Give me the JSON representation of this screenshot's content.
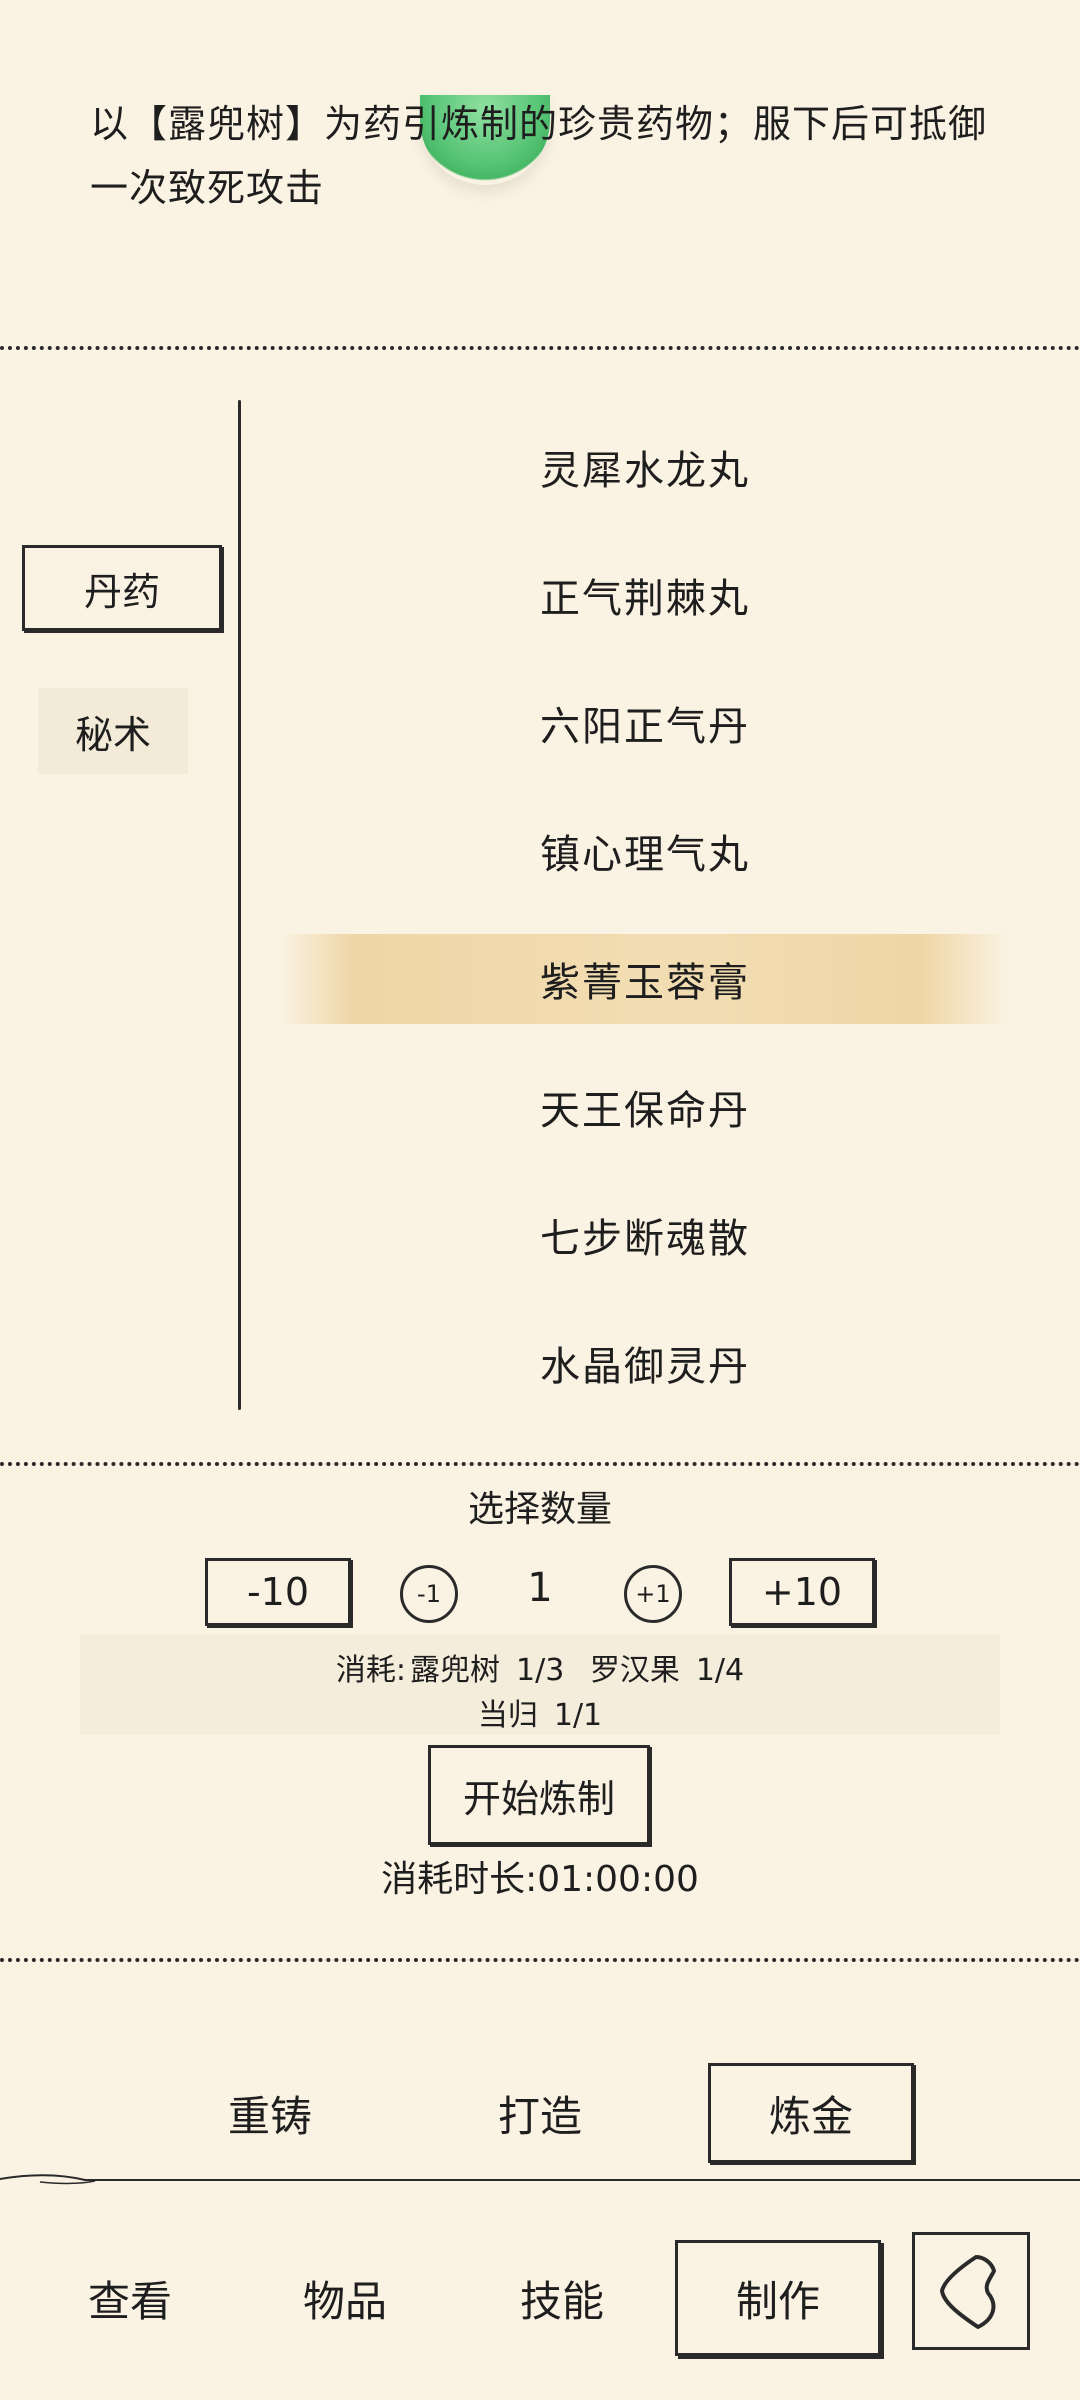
{
  "description": {
    "line1": "以【露兜树】为药引炼制的珍贵药物；服下后可抵御",
    "line2": "一次致死攻击"
  },
  "categories": [
    {
      "label": "丹药",
      "active": true
    },
    {
      "label": "秘术",
      "active": false
    }
  ],
  "recipes": [
    {
      "label": "灵犀水龙丸"
    },
    {
      "label": "正气荆棘丸"
    },
    {
      "label": "六阳正气丹"
    },
    {
      "label": "镇心理气丸"
    },
    {
      "label": "紫菁玉蓉膏",
      "selected": true
    },
    {
      "label": "天王保命丹"
    },
    {
      "label": "七步断魂散"
    },
    {
      "label": "水晶御灵丹"
    }
  ],
  "quantity": {
    "title": "选择数量",
    "minus10": "-10",
    "minus1": "-1",
    "value": "1",
    "plus1": "+1",
    "plus10": "+10"
  },
  "cost": {
    "prefix": "消耗:",
    "items": [
      {
        "name": "露兜树",
        "amount": "1/3"
      },
      {
        "name": "罗汉果",
        "amount": "1/4"
      },
      {
        "name": "当归",
        "amount": "1/1"
      }
    ]
  },
  "start_button": "开始炼制",
  "duration": "消耗时长:01:00:00",
  "subtabs": [
    {
      "label": "重铸",
      "active": false
    },
    {
      "label": "打造",
      "active": false
    },
    {
      "label": "炼金",
      "active": true
    }
  ],
  "nav": [
    {
      "label": "查看",
      "active": false
    },
    {
      "label": "物品",
      "active": false
    },
    {
      "label": "技能",
      "active": false
    },
    {
      "label": "制作",
      "active": true
    }
  ],
  "icons": {
    "back": "back-arrow-icon",
    "orb": "green-orb-icon"
  }
}
